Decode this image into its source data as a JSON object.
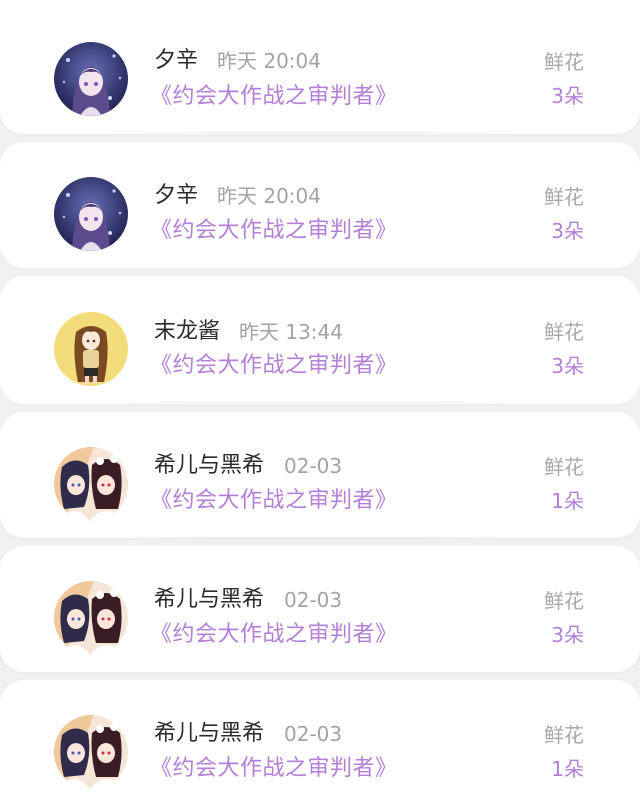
{
  "colors": {
    "accent": "#b37fd8",
    "name_text": "#2b2b2b",
    "secondary_text": "#a3a3a3",
    "background": "#f1f1f3"
  },
  "entries": [
    {
      "user": "夕辛",
      "time": "昨天 20:04",
      "book": "《约会大作战之审判者》",
      "gift_label": "鲜花",
      "gift_count": "3朵",
      "avatar_icon": "anime-avatar-dark-purple-icon"
    },
    {
      "user": "夕辛",
      "time": "昨天 20:04",
      "book": "《约会大作战之审判者》",
      "gift_label": "鲜花",
      "gift_count": "3朵",
      "avatar_icon": "anime-avatar-dark-purple-icon"
    },
    {
      "user": "末龙酱",
      "time": "昨天 13:44",
      "book": "《约会大作战之审判者》",
      "gift_label": "鲜花",
      "gift_count": "3朵",
      "avatar_icon": "anime-avatar-yellow-icon"
    },
    {
      "user": "希儿与黑希",
      "time": "02-03",
      "book": "《约会大作战之审判者》",
      "gift_label": "鲜花",
      "gift_count": "1朵",
      "avatar_icon": "anime-avatar-pair-icon"
    },
    {
      "user": "希儿与黑希",
      "time": "02-03",
      "book": "《约会大作战之审判者》",
      "gift_label": "鲜花",
      "gift_count": "3朵",
      "avatar_icon": "anime-avatar-pair-icon"
    },
    {
      "user": "希儿与黑希",
      "time": "02-03",
      "book": "《约会大作战之审判者》",
      "gift_label": "鲜花",
      "gift_count": "1朵",
      "avatar_icon": "anime-avatar-pair-icon"
    }
  ]
}
